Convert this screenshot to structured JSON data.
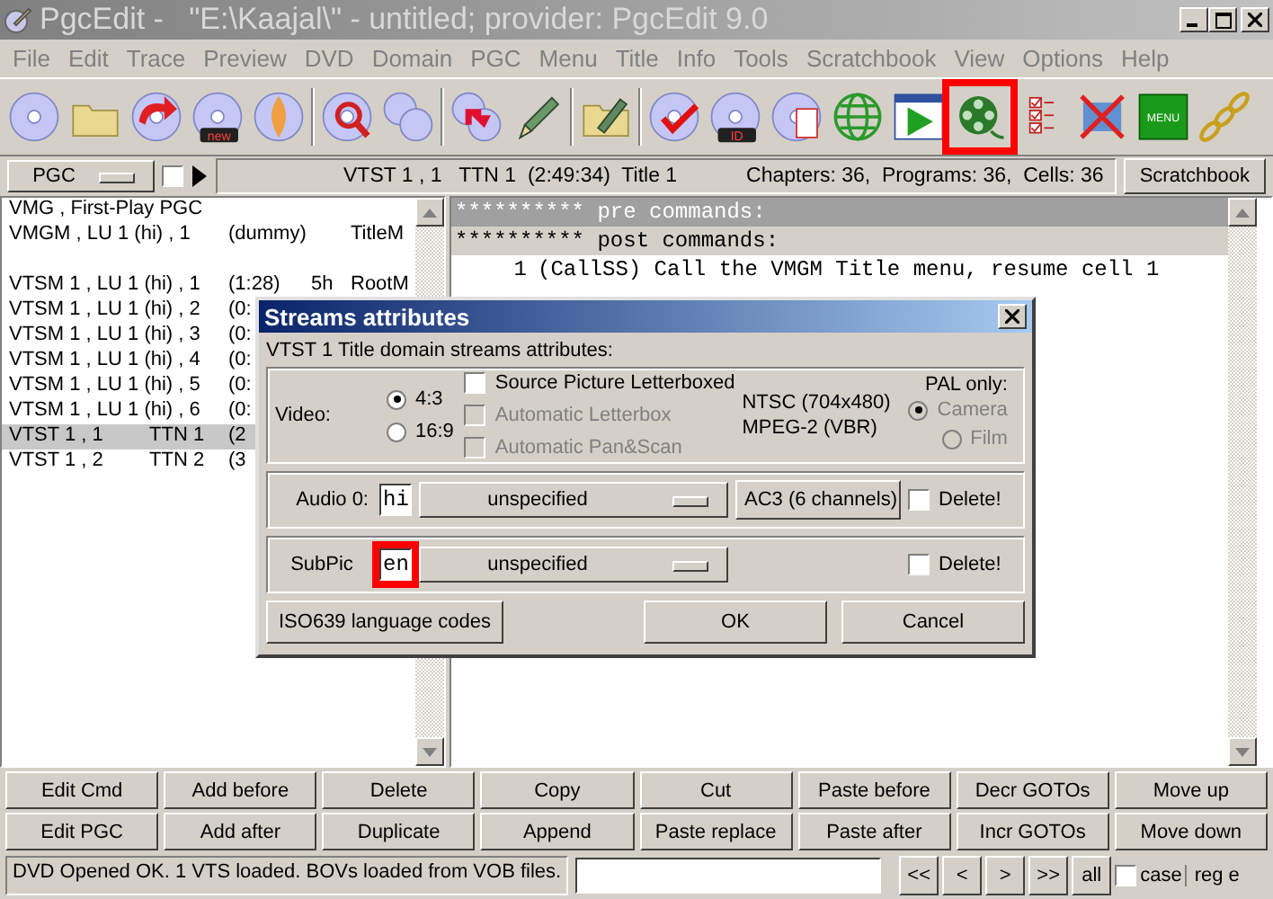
{
  "window": {
    "title": "PgcEdit -   \"E:\\Kaajal\\\" - untitled; provider: PgcEdit 9.0"
  },
  "menu": [
    "File",
    "Edit",
    "Trace",
    "Preview",
    "DVD",
    "Domain",
    "PGC",
    "Menu",
    "Title",
    "Info",
    "Tools",
    "Scratchbook",
    "View",
    "Options",
    "Help"
  ],
  "toolbar": [
    {
      "kind": "disc",
      "highlighted": false
    },
    {
      "kind": "folder",
      "highlighted": false
    },
    {
      "kind": "disc-arrow",
      "highlighted": false
    },
    {
      "kind": "disc-new",
      "label": "new",
      "highlighted": false
    },
    {
      "kind": "disc-flame",
      "highlighted": false
    },
    {
      "kind": "disc-search",
      "highlighted": false
    },
    {
      "kind": "discs",
      "highlighted": false
    },
    {
      "kind": "discs-arrow",
      "highlighted": false
    },
    {
      "kind": "pen",
      "highlighted": false
    },
    {
      "kind": "folder-pen",
      "highlighted": false
    },
    {
      "kind": "disc-check",
      "highlighted": false
    },
    {
      "kind": "disc-id",
      "label": "ID",
      "highlighted": false
    },
    {
      "kind": "disc-doc",
      "highlighted": false
    },
    {
      "kind": "globe",
      "highlighted": false
    },
    {
      "kind": "play",
      "highlighted": false
    },
    {
      "kind": "film",
      "highlighted": true
    },
    {
      "kind": "checklist",
      "highlighted": false
    },
    {
      "kind": "film-cross",
      "highlighted": false
    },
    {
      "kind": "menu",
      "label": "MENU",
      "highlighted": false
    },
    {
      "kind": "chain",
      "highlighted": false
    }
  ],
  "infobar": {
    "domain_select": "PGC",
    "checkbox_checked": false,
    "pgc_info": "VTST 1 , 1   TTN 1  (2:49:34)  Title 1",
    "counts": "Chapters: 36,  Programs: 36,  Cells: 36",
    "button": "Scratchbook"
  },
  "pgc_list": [
    {
      "rows": [
        {
          "cells": [
            "VMG , First-Play PGC"
          ],
          "selected": false
        },
        {
          "cells": [
            "VMGM , LU 1 (hi) , 1",
            "",
            "(dummy)",
            "",
            "TitleM"
          ],
          "selected": false
        }
      ]
    },
    {
      "rows": [
        {
          "cells": [
            "VTSM 1 , LU 1 (hi) , 1",
            "",
            "(1:28)",
            "5h",
            "RootM"
          ],
          "selected": false
        },
        {
          "cells": [
            "VTSM 1 , LU 1 (hi) , 2",
            "",
            "(0:"
          ],
          "selected": false
        },
        {
          "cells": [
            "VTSM 1 , LU 1 (hi) , 3",
            "",
            "(0:"
          ],
          "selected": false
        },
        {
          "cells": [
            "VTSM 1 , LU 1 (hi) , 4",
            "",
            "(0:"
          ],
          "selected": false
        },
        {
          "cells": [
            "VTSM 1 , LU 1 (hi) , 5",
            "",
            "(0:"
          ],
          "selected": false
        },
        {
          "cells": [
            "VTSM 1 , LU 1 (hi) , 6",
            "",
            "(0:"
          ],
          "selected": false
        },
        {
          "cells": [
            "VTST 1 , 1",
            "TTN 1",
            "(2"
          ],
          "selected": true
        },
        {
          "cells": [
            "VTST 1 , 2",
            "TTN 2",
            "(3"
          ],
          "selected": false
        }
      ]
    }
  ],
  "commands": [
    {
      "kind": "header-pre",
      "text": "********** pre commands:"
    },
    {
      "kind": "header-post",
      "text": "********** post commands:"
    },
    {
      "kind": "command",
      "number": "1",
      "text": "(CallSS) Call the VMGM Title menu, resume cell 1"
    }
  ],
  "dialog": {
    "title": "Streams attributes",
    "subtitle": "VTST 1 Title domain streams attributes:",
    "video": {
      "label": "Video:",
      "aspect": [
        {
          "label": "4:3",
          "selected": true
        },
        {
          "label": "16:9",
          "selected": false
        }
      ],
      "options": [
        {
          "label": "Source Picture Letterboxed",
          "checked": false,
          "disabled": false
        },
        {
          "label": "Automatic Letterbox",
          "checked": false,
          "disabled": true
        },
        {
          "label": "Automatic Pan&Scan",
          "checked": false,
          "disabled": true
        }
      ],
      "format": [
        "NTSC (704x480)",
        "MPEG-2 (VBR)"
      ],
      "pal_label": "PAL only:",
      "pal": [
        {
          "label": "Camera",
          "selected": true,
          "disabled": true
        },
        {
          "label": "Film",
          "selected": false,
          "disabled": true
        }
      ]
    },
    "streams": [
      {
        "kind": "audio",
        "label": "Audio 0:",
        "lang": "hi",
        "lang_highlighted": false,
        "mode": "unspecified",
        "format": "AC3 (6 channels)",
        "delete_label": "Delete!",
        "delete_checked": false
      },
      {
        "kind": "subpic",
        "label": "SubPic",
        "lang": "en",
        "lang_highlighted": true,
        "mode": "unspecified",
        "delete_label": "Delete!",
        "delete_checked": false
      }
    ],
    "buttons": [
      "ISO639 language codes",
      "OK",
      "Cancel"
    ]
  },
  "action_buttons": [
    "Edit Cmd",
    "Add before",
    "Delete",
    "Copy",
    "Cut",
    "Paste before",
    "Decr GOTOs",
    "Move up",
    "Edit PGC",
    "Add after",
    "Duplicate",
    "Append",
    "Paste replace",
    "Paste after",
    "Incr GOTOs",
    "Move down"
  ],
  "status_bar": {
    "message": "DVD Opened OK.  1 VTS loaded.  BOVs loaded from VOB files.",
    "search_nav": [
      "<<",
      "<",
      ">",
      ">>",
      "all"
    ],
    "case_label": "case",
    "case_checked": false,
    "regex_label": "reg e"
  }
}
